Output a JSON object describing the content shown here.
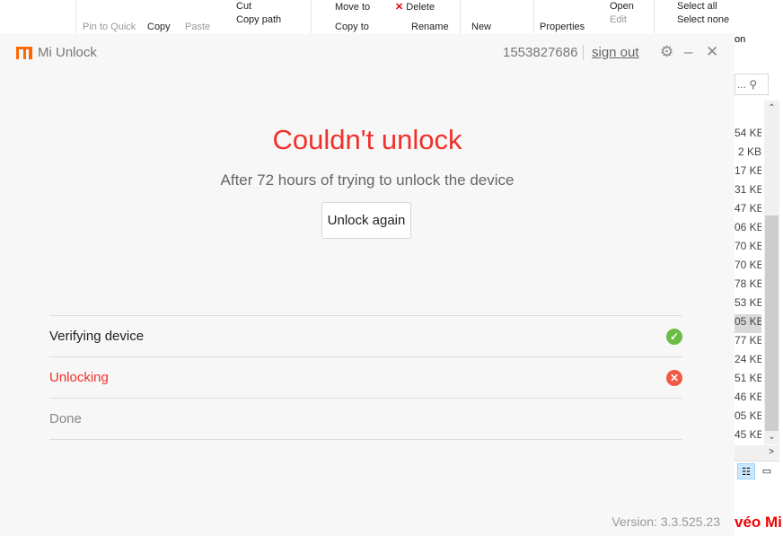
{
  "explorer": {
    "ribbon": {
      "pin": "Pin to Quick",
      "copy": "Copy",
      "paste": "Paste",
      "cut": "Cut",
      "copy_path": "Copy path",
      "move_to": "Move to",
      "copy_to": "Copy to",
      "delete": "Delete",
      "rename": "Rename",
      "new": "New",
      "properties": "Properties",
      "open": "Open",
      "edit": "Edit",
      "select_all": "Select all",
      "select_none": "Select none",
      "selection_partial": "on"
    },
    "search_placeholder": "...",
    "sizes": [
      "54 KB",
      "2 KB",
      "17 KB",
      "31 KB",
      "47 KB",
      "06 KB",
      "70 KB",
      "70 KB",
      "78 KB",
      "53 KB",
      "05 KB",
      "77 KB",
      "24 KB",
      "51 KB",
      "46 KB",
      "05 KB",
      "45 KB"
    ],
    "promo_text": "véo Mi"
  },
  "app": {
    "title": "Mi Unlock",
    "account_id": "1553827686",
    "sign_out": "sign out",
    "heading": "Couldn't unlock",
    "subtitle": "After 72 hours of trying to unlock the device",
    "unlock_again": "Unlock again",
    "steps": [
      {
        "label": "Verifying device",
        "status": "success",
        "color": "#222222",
        "icon_color": "#6cbb45"
      },
      {
        "label": "Unlocking",
        "status": "failed",
        "color": "#f0302a",
        "icon_color": "#f25a46"
      },
      {
        "label": "Done",
        "status": "pending",
        "color": "#888888"
      }
    ],
    "version": "Version: 3.3.525.23",
    "accent": "#ff6700"
  }
}
